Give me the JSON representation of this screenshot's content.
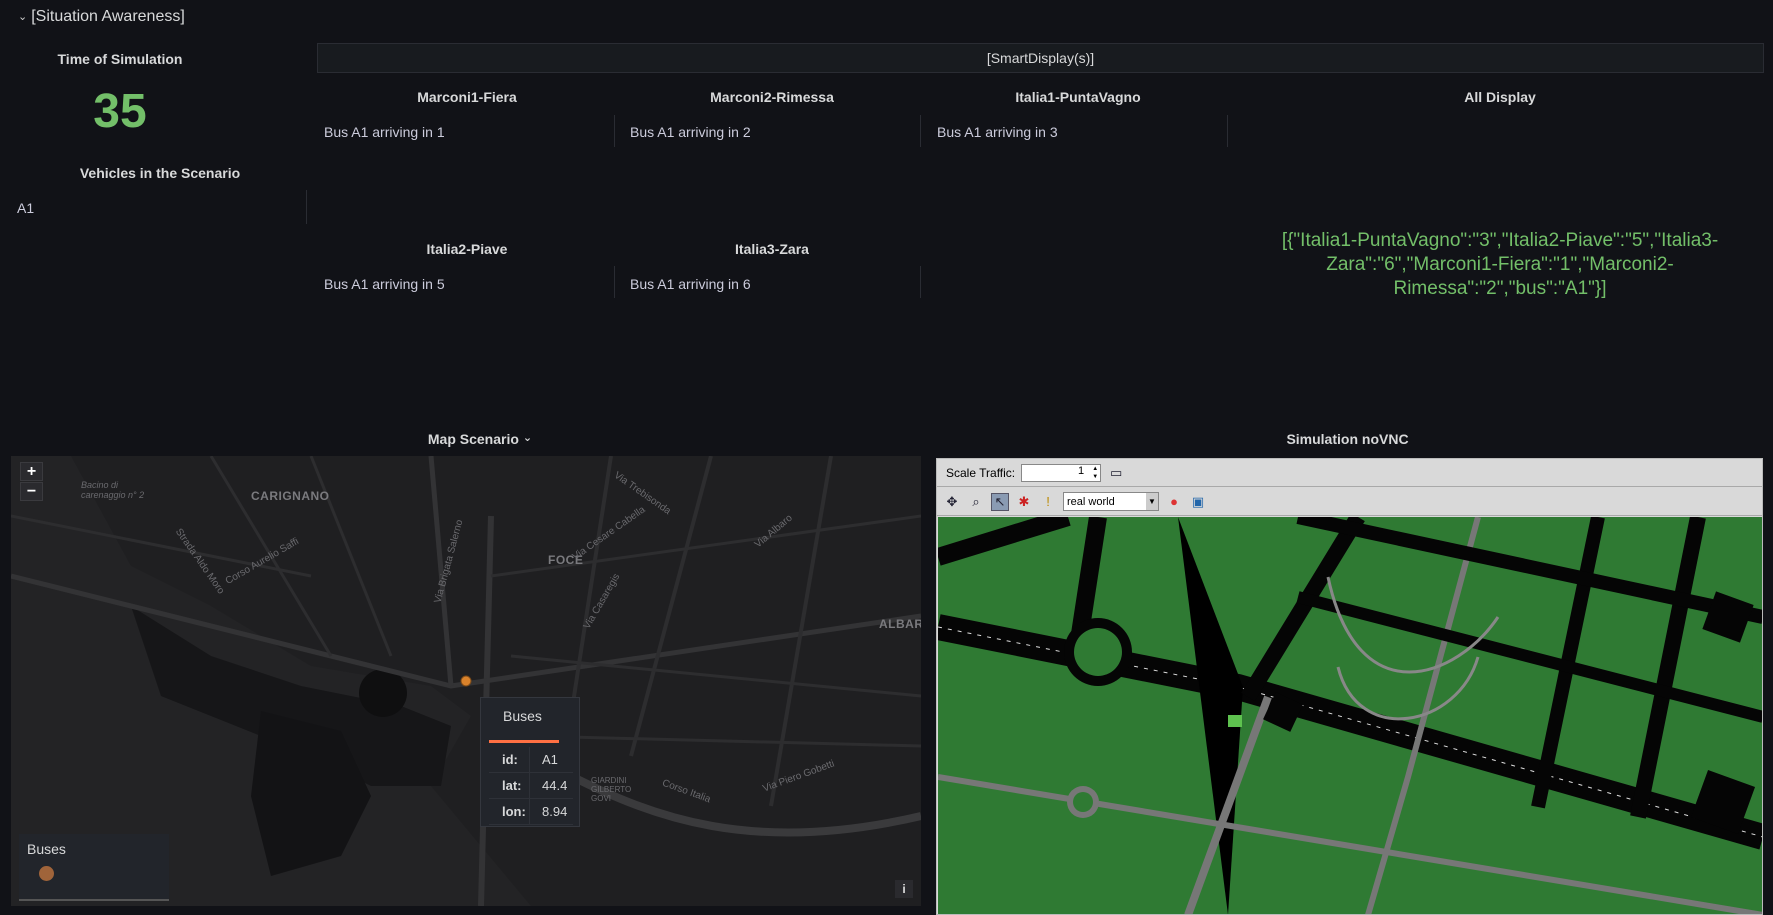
{
  "row": {
    "title": "[Situation Awareness]"
  },
  "time_panel": {
    "title": "Time of Simulation",
    "value": "35"
  },
  "vehicles_panel": {
    "title": "Vehicles in the Scenario",
    "items": [
      "A1"
    ]
  },
  "smart_display": {
    "header": "[SmartDisplay(s)]",
    "displays": [
      {
        "name": "Marconi1-Fiera",
        "text": "Bus A1 arriving in 1"
      },
      {
        "name": "Marconi2-Rimessa",
        "text": "Bus A1 arriving in 2"
      },
      {
        "name": "Italia1-PuntaVagno",
        "text": "Bus A1 arriving in 3"
      },
      {
        "name": "Italia2-Piave",
        "text": "Bus A1 arriving in 5"
      },
      {
        "name": "Italia3-Zara",
        "text": "Bus A1 arriving in 6"
      }
    ],
    "all_display": {
      "title": "All Display",
      "value": "[{\"Italia1-PuntaVagno\":\"3\",\"Italia2-Piave\":\"5\",\"Italia3-Zara\":\"6\",\"Marconi1-Fiera\":\"1\",\"Marconi2-Rimessa\":\"2\",\"bus\":\"A1\"}]"
    }
  },
  "map_panel": {
    "title": "Map Scenario",
    "zoom_in": "+",
    "zoom_out": "−",
    "labels": {
      "carignano": "CARIGNANO",
      "foce": "FOCE",
      "albaro": "ALBAR",
      "bacino": "Bacino di carenaggio n° 2",
      "giardini": "GIARDINI GILBERTO GOVI"
    },
    "streets": [
      "Strada Aldo Moro",
      "Corso Aurelio Saffi",
      "Via Brigata Salerno",
      "Via Cesare Cabella",
      "Via Trebisonda",
      "Via Casaregis",
      "Via Albaro",
      "Corso Italia",
      "Via Piero Gobetti"
    ],
    "tooltip": {
      "title": "Buses",
      "rows": [
        {
          "key": "id:",
          "value": "A1"
        },
        {
          "key": "lat:",
          "value": "44.4"
        },
        {
          "key": "lon:",
          "value": "8.94"
        }
      ]
    },
    "legend": {
      "title": "Buses",
      "color": "#a0643a"
    },
    "info": "i",
    "marker_color": "#d9822b"
  },
  "vnc_panel": {
    "title": "Simulation noVNC",
    "scale_label": "Scale Traffic:",
    "scale_value": "1",
    "view_option": "real world",
    "ground_color": "#2f7a33"
  }
}
